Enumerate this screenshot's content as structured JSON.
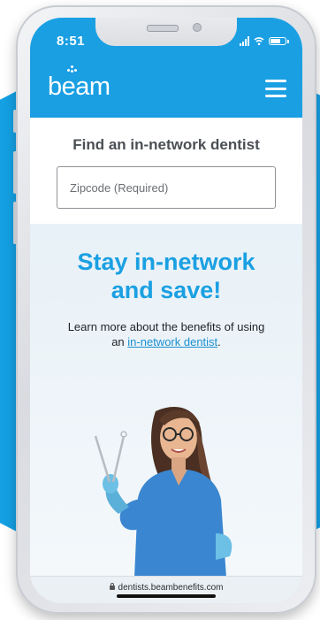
{
  "status_bar": {
    "time": "8:51"
  },
  "header": {
    "logo_text": "beam",
    "menu_icon": "hamburger-menu-icon"
  },
  "search": {
    "title": "Find an in-network dentist",
    "zip_placeholder": "Zipcode (Required)",
    "zip_value": ""
  },
  "promo": {
    "headline_line1": "Stay in-network",
    "headline_line2": "and save!",
    "body_text": "Learn more about the benefits of using an",
    "link_text": "in-network dentist",
    "body_suffix": ".",
    "illustration": "dentist-with-tools-image"
  },
  "browser": {
    "url": "dentists.beambenefits.com",
    "lock_icon": "lock-icon"
  },
  "colors": {
    "brand_blue": "#1a9fe3",
    "headline_blue": "#1aa0e2",
    "link_blue": "#1a8fd0"
  }
}
